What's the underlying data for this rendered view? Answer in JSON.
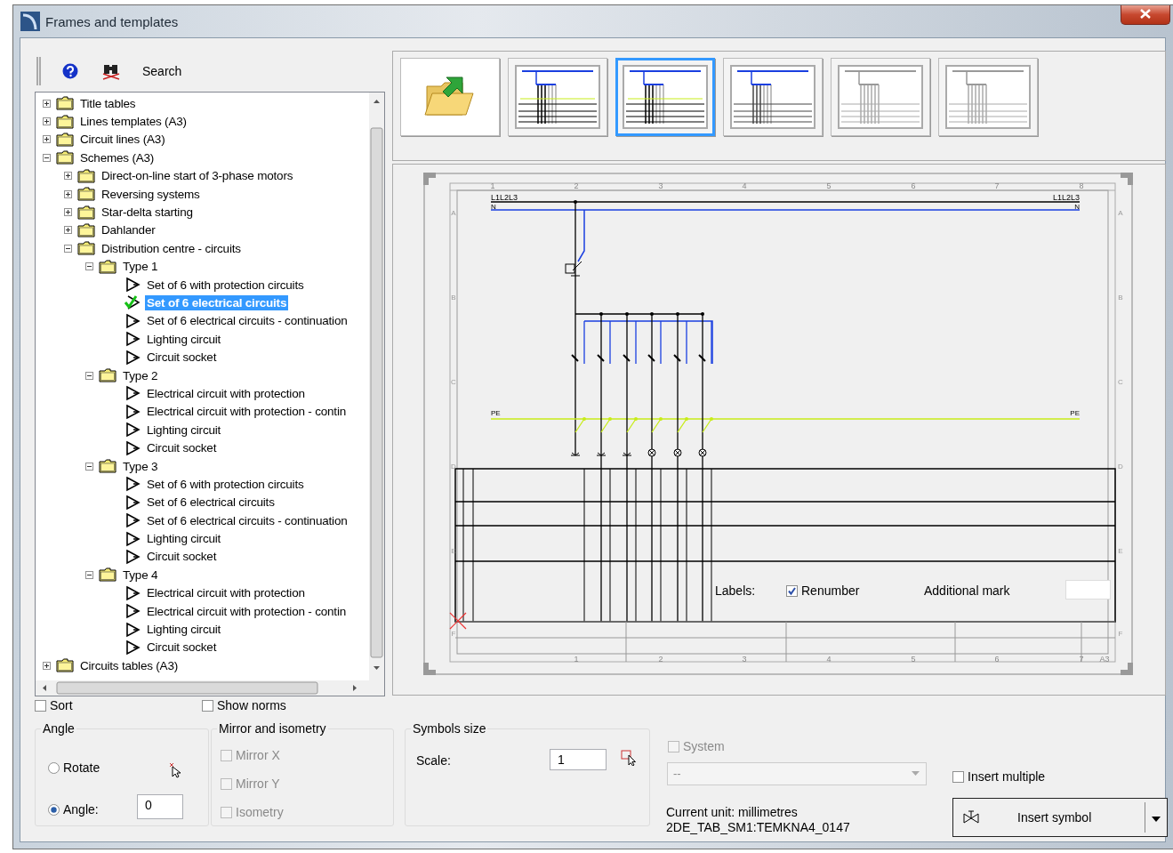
{
  "window": {
    "title": "Frames and templates"
  },
  "toolbar": {
    "search_label": "Search"
  },
  "tree": [
    {
      "label": "Title tables",
      "kind": "folder",
      "expanded": false,
      "selected": false
    },
    {
      "label": "Lines templates (A3)",
      "kind": "folder",
      "expanded": false,
      "selected": false
    },
    {
      "label": "Circuit lines (A3)",
      "kind": "folder",
      "expanded": false,
      "selected": false
    },
    {
      "label": "Schemes (A3)",
      "kind": "folder",
      "expanded": true,
      "selected": false,
      "children": [
        {
          "label": "Direct-on-line start of 3-phase motors",
          "kind": "folder",
          "expanded": false,
          "selected": false
        },
        {
          "label": "Reversing systems",
          "kind": "folder",
          "expanded": false,
          "selected": false
        },
        {
          "label": "Star-delta starting",
          "kind": "folder",
          "expanded": false,
          "selected": false
        },
        {
          "label": "Dahlander",
          "kind": "folder",
          "expanded": false,
          "selected": false
        },
        {
          "label": "Distribution centre - circuits",
          "kind": "folder",
          "expanded": true,
          "selected": false,
          "children": [
            {
              "label": "Type 1",
              "kind": "folder",
              "expanded": true,
              "selected": false,
              "children": [
                {
                  "label": "Set of 6 with protection circuits",
                  "kind": "symbol",
                  "selected": false
                },
                {
                  "label": "Set of 6 electrical circuits",
                  "kind": "symbol",
                  "selected": true
                },
                {
                  "label": "Set of 6 electrical circuits - continuation",
                  "kind": "symbol",
                  "selected": false
                },
                {
                  "label": "Lighting circuit",
                  "kind": "symbol",
                  "selected": false
                },
                {
                  "label": "Circuit socket",
                  "kind": "symbol",
                  "selected": false
                }
              ]
            },
            {
              "label": "Type 2",
              "kind": "folder",
              "expanded": true,
              "selected": false,
              "children": [
                {
                  "label": "Electrical circuit with protection",
                  "kind": "symbol",
                  "selected": false
                },
                {
                  "label": "Electrical circuit with protection - contin",
                  "kind": "symbol",
                  "selected": false
                },
                {
                  "label": "Lighting circuit",
                  "kind": "symbol",
                  "selected": false
                },
                {
                  "label": "Circuit socket",
                  "kind": "symbol",
                  "selected": false
                }
              ]
            },
            {
              "label": "Type 3",
              "kind": "folder",
              "expanded": true,
              "selected": false,
              "children": [
                {
                  "label": "Set of 6 with protection circuits",
                  "kind": "symbol",
                  "selected": false
                },
                {
                  "label": "Set of 6 electrical circuits",
                  "kind": "symbol",
                  "selected": false
                },
                {
                  "label": "Set of 6 electrical circuits - continuation",
                  "kind": "symbol",
                  "selected": false
                },
                {
                  "label": "Lighting circuit",
                  "kind": "symbol",
                  "selected": false
                },
                {
                  "label": "Circuit socket",
                  "kind": "symbol",
                  "selected": false
                }
              ]
            },
            {
              "label": "Type 4",
              "kind": "folder",
              "expanded": true,
              "selected": false,
              "children": [
                {
                  "label": "Electrical circuit with protection",
                  "kind": "symbol",
                  "selected": false
                },
                {
                  "label": "Electrical circuit with protection - contin",
                  "kind": "symbol",
                  "selected": false
                },
                {
                  "label": "Lighting circuit",
                  "kind": "symbol",
                  "selected": false
                },
                {
                  "label": "Circuit socket",
                  "kind": "symbol",
                  "selected": false
                }
              ]
            }
          ]
        }
      ]
    },
    {
      "label": "Circuits tables (A3)",
      "kind": "folder",
      "expanded": false,
      "selected": false
    }
  ],
  "thumbnails": [
    {
      "kind": "folder",
      "selected": false
    },
    {
      "kind": "template",
      "selected": false
    },
    {
      "kind": "template",
      "selected": true
    },
    {
      "kind": "template-grey",
      "selected": false
    },
    {
      "kind": "template-faded",
      "selected": false
    },
    {
      "kind": "template-faded",
      "selected": false
    }
  ],
  "preview": {
    "column_numbers": [
      "1",
      "2",
      "3",
      "4",
      "5",
      "6",
      "7",
      "8"
    ],
    "bottom_numbers": [
      "1",
      "2",
      "3",
      "4",
      "5",
      "6",
      "7",
      "A3"
    ],
    "row_letters_left": [
      "A",
      "B",
      "C",
      "D",
      "E",
      "F"
    ],
    "row_letters_right": [
      "A",
      "B",
      "C",
      "D",
      "E",
      "F"
    ],
    "phase_labels": [
      "L1L2L3",
      "L1L2L3"
    ],
    "neutral_labels": [
      "N",
      "N"
    ],
    "pe_labels": [
      "PE",
      "PE"
    ],
    "labels_caption": "Labels:",
    "renumber": {
      "label": "Renumber",
      "checked": true
    },
    "additional_mark": {
      "label": "Additional mark"
    }
  },
  "options": {
    "sort": {
      "label": "Sort",
      "checked": false
    },
    "show_norms": {
      "label": "Show norms",
      "checked": false
    },
    "angle": {
      "title": "Angle",
      "rotate": {
        "label": "Rotate",
        "selected": false
      },
      "angle": {
        "label": "Angle:",
        "selected": true,
        "value": "0"
      }
    },
    "mirror": {
      "title": "Mirror and isometry",
      "items": [
        {
          "label": "Mirror X",
          "checked": false,
          "disabled": true
        },
        {
          "label": "Mirror Y",
          "checked": false,
          "disabled": true
        },
        {
          "label": "Isometry",
          "checked": false,
          "disabled": true
        }
      ]
    },
    "symbols_size": {
      "title": "Symbols size",
      "scale_label": "Scale:",
      "scale_value": "1"
    },
    "system": {
      "label": "System",
      "checked": false,
      "disabled": true
    },
    "system_select": {
      "value": "--",
      "disabled": true
    },
    "insert_multiple": {
      "label": "Insert multiple",
      "checked": false
    },
    "current_unit": "Current unit: millimetres",
    "symbol_code": "2DE_TAB_SM1:TEMKNA4_0147",
    "insert_button": "Insert symbol"
  }
}
